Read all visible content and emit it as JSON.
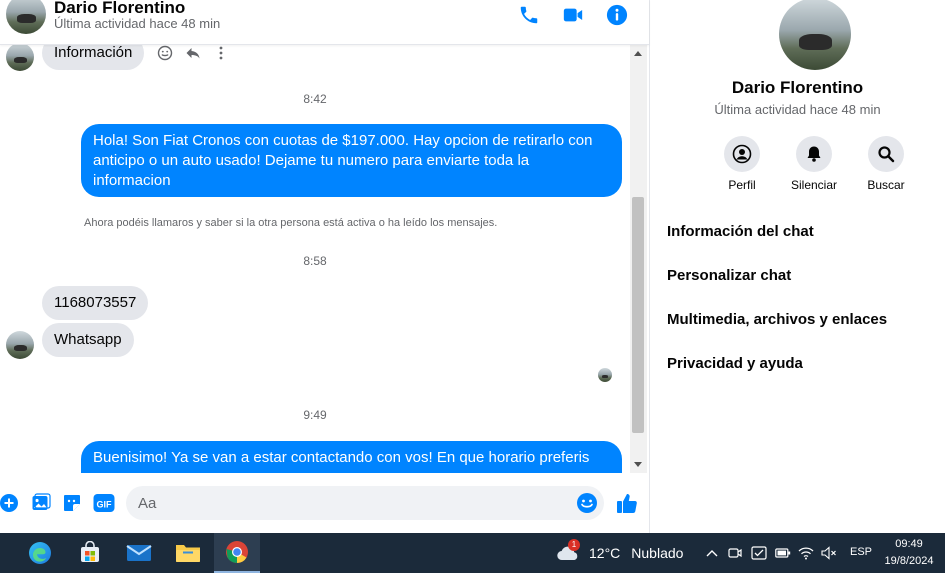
{
  "header": {
    "name": "Dario Florentino",
    "status": "Última actividad hace 48 min",
    "icons": [
      "phone-icon",
      "video-camera-icon",
      "info-icon"
    ],
    "accent_color": "#0084ff"
  },
  "messages": {
    "partial_bubble": "Información",
    "time_1": "8:42",
    "outgoing_1": "Hola! Son Fiat Cronos con cuotas de $197.000. Hay opcion de retirarlo con anticipo o un auto usado! Dejame tu numero para enviarte toda la informacion",
    "notice": "Ahora podéis llamaros y saber si la otra persona está activa o ha leído los mensajes.",
    "time_2": "8:58",
    "incoming_1": "1168073557",
    "incoming_2": "Whatsapp",
    "time_3": "9:49",
    "outgoing_2_visible": "Buenisimo! Ya se van a estar contactando con vos! En que horario preferis que"
  },
  "composer": {
    "placeholder": "Aa",
    "icons": [
      "plus-icon",
      "image-icon",
      "sticker-icon",
      "gif-icon",
      "emoji-icon",
      "thumbs-up-icon"
    ]
  },
  "info_panel": {
    "name": "Dario Florentino",
    "status": "Última actividad hace 48 min",
    "actions": [
      {
        "label": "Perfil",
        "icon": "profile-icon"
      },
      {
        "label": "Silenciar",
        "icon": "bell-icon"
      },
      {
        "label": "Buscar",
        "icon": "search-icon"
      }
    ],
    "menu": [
      "Información del chat",
      "Personalizar chat",
      "Multimedia, archivos y enlaces",
      "Privacidad y ayuda"
    ]
  },
  "taskbar": {
    "apps": [
      "edge-icon",
      "store-icon",
      "mail-icon",
      "file-explorer-icon",
      "chrome-icon"
    ],
    "weather_badge": "1",
    "temperature": "12°C",
    "weather": "Nublado",
    "language": "ESP",
    "time": "09:49",
    "date": "19/8/2024"
  }
}
